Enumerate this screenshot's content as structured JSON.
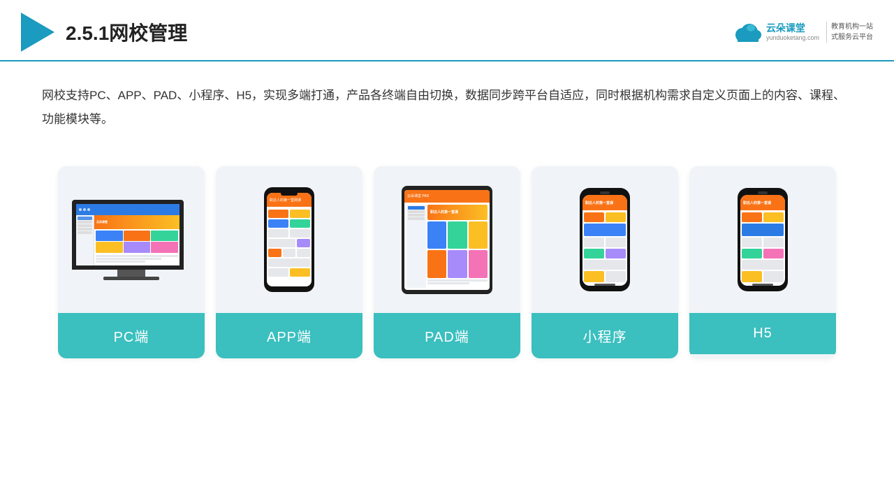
{
  "header": {
    "title": "2.5.1网校管理",
    "brand_name": "云朵课堂",
    "brand_url": "yunduoketang.com",
    "brand_slogan": "教育机构一站\n式服务云平台"
  },
  "description": "网校支持PC、APP、PAD、小程序、H5，实现多端打通，产品各终端自由切换，数据同步跨平台自适应，同时根据机构需求自定义页面上的内容、课程、功能模块等。",
  "cards": [
    {
      "id": "pc",
      "label": "PC端"
    },
    {
      "id": "app",
      "label": "APP端"
    },
    {
      "id": "pad",
      "label": "PAD端"
    },
    {
      "id": "mini",
      "label": "小程序"
    },
    {
      "id": "h5",
      "label": "H5"
    }
  ],
  "colors": {
    "accent": "#1a9bbf",
    "card_bg": "#eef2f7",
    "card_label_bg": "#3bbfbf",
    "card_label_text": "#ffffff",
    "orange": "#f97316",
    "yellow": "#fbbf24",
    "blue": "#2c7be5",
    "green": "#34d399",
    "purple": "#a78bfa",
    "pink": "#f472b6"
  }
}
